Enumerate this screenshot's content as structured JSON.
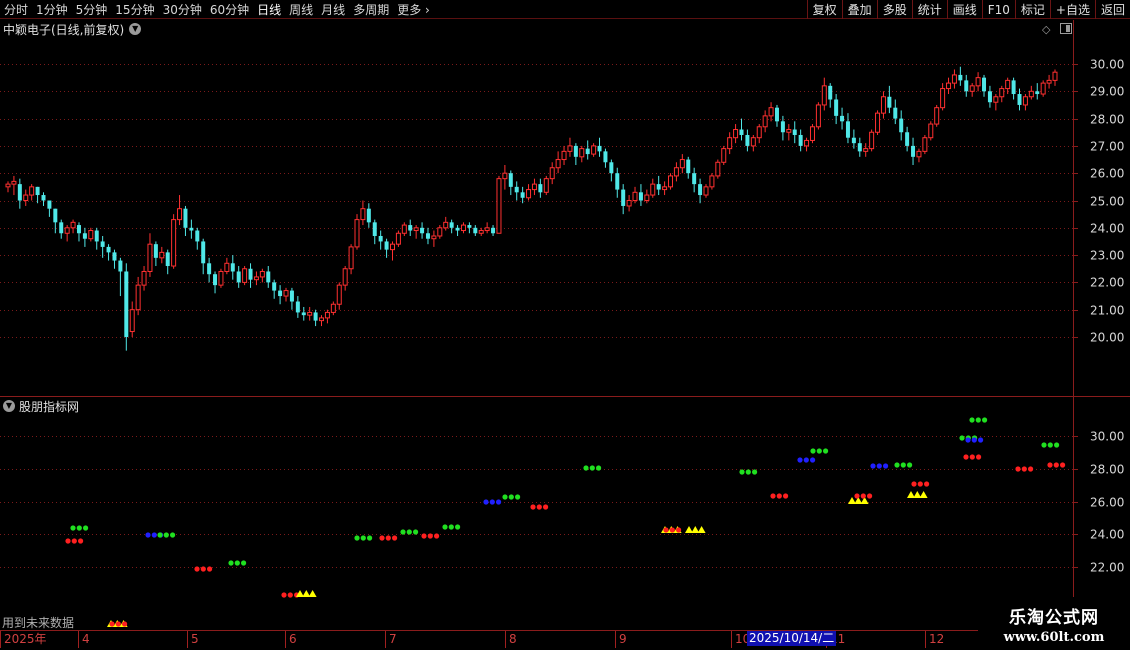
{
  "toolbar": {
    "periods": [
      "分时",
      "1分钟",
      "5分钟",
      "15分钟",
      "30分钟",
      "60分钟",
      "日线",
      "周线",
      "月线",
      "多周期",
      "更多"
    ],
    "active_period": "日线",
    "right_buttons": [
      "复权",
      "叠加",
      "多股",
      "统计",
      "画线",
      "F10",
      "标记",
      "+自选",
      "返回"
    ]
  },
  "main_chart": {
    "title": "中颖电子(日线,前复权)",
    "y_labels": [
      "30.00",
      "29.00",
      "28.00",
      "27.00",
      "26.00",
      "25.00",
      "24.00",
      "23.00",
      "22.00",
      "21.00",
      "20.00"
    ]
  },
  "panel": {
    "title": "股朋指标网",
    "y_labels": [
      "30.00",
      "28.00",
      "26.00",
      "24.00",
      "22.00"
    ],
    "note": "用到未来数据"
  },
  "date_axis": {
    "months": [
      "2025年",
      "4",
      "5",
      "6",
      "7",
      "8",
      "9",
      "10",
      "11",
      "12"
    ],
    "cursor_date": "2025/10/14/二"
  },
  "watermark": {
    "name": "乐淘公式网",
    "url": "www.60lt.com"
  },
  "colors": {
    "up": "#ff3030",
    "down": "#50e8e8",
    "grid": "#7a1a1a",
    "red_dot": "#ff2020",
    "green_dot": "#20e020",
    "blue_dot": "#2020ff",
    "yellow_tri": "#ffff00"
  },
  "chart_data": {
    "type": "candlestick",
    "ylim": [
      19.5,
      30.5
    ],
    "candles": [
      [
        25.5,
        25.7,
        25.6,
        25.3
      ],
      [
        25.6,
        25.9,
        25.7,
        25.2
      ],
      [
        25.6,
        25.8,
        25.0,
        24.7
      ],
      [
        25.0,
        25.4,
        25.2,
        24.8
      ],
      [
        25.2,
        25.6,
        25.5,
        25.0
      ],
      [
        25.5,
        25.5,
        25.2,
        24.9
      ],
      [
        25.2,
        25.3,
        25.0,
        24.8
      ],
      [
        25.0,
        25.0,
        24.7,
        24.4
      ],
      [
        24.7,
        24.7,
        24.2,
        23.8
      ],
      [
        24.2,
        24.3,
        23.8,
        23.6
      ],
      [
        23.8,
        24.1,
        24.0,
        23.5
      ],
      [
        24.0,
        24.3,
        24.2,
        23.8
      ],
      [
        24.1,
        24.2,
        23.8,
        23.5
      ],
      [
        23.8,
        24.0,
        23.6,
        23.3
      ],
      [
        23.6,
        24.0,
        23.9,
        23.5
      ],
      [
        23.9,
        24.0,
        23.5,
        23.2
      ],
      [
        23.5,
        23.7,
        23.3,
        22.9
      ],
      [
        23.3,
        23.4,
        23.1,
        22.8
      ],
      [
        23.1,
        23.2,
        22.8,
        22.5
      ],
      [
        22.8,
        22.9,
        22.4,
        21.5
      ],
      [
        22.4,
        22.7,
        20.0,
        19.5
      ],
      [
        20.2,
        21.3,
        21.0,
        20.0
      ],
      [
        21.0,
        22.2,
        21.9,
        20.8
      ],
      [
        21.9,
        22.6,
        22.4,
        21.7
      ],
      [
        22.4,
        23.8,
        23.4,
        22.2
      ],
      [
        23.4,
        23.5,
        22.9,
        22.6
      ],
      [
        22.9,
        23.3,
        23.1,
        22.7
      ],
      [
        23.1,
        23.2,
        22.6,
        22.3
      ],
      [
        22.6,
        24.5,
        24.3,
        22.5
      ],
      [
        24.3,
        25.2,
        24.7,
        24.1
      ],
      [
        24.7,
        24.8,
        24.0,
        23.7
      ],
      [
        24.0,
        24.3,
        23.9,
        23.6
      ],
      [
        23.9,
        24.0,
        23.5,
        23.2
      ],
      [
        23.5,
        23.6,
        22.7,
        22.3
      ],
      [
        22.7,
        22.9,
        22.3,
        22.0
      ],
      [
        22.3,
        22.4,
        21.9,
        21.6
      ],
      [
        21.9,
        22.5,
        22.4,
        21.8
      ],
      [
        22.4,
        22.9,
        22.7,
        22.3
      ],
      [
        22.7,
        23.0,
        22.4,
        22.1
      ],
      [
        22.4,
        22.6,
        22.0,
        21.8
      ],
      [
        22.0,
        22.6,
        22.5,
        21.9
      ],
      [
        22.5,
        22.7,
        22.1,
        21.8
      ],
      [
        22.1,
        22.4,
        22.2,
        21.9
      ],
      [
        22.2,
        22.5,
        22.4,
        22.0
      ],
      [
        22.4,
        22.6,
        22.0,
        21.8
      ],
      [
        22.0,
        22.1,
        21.7,
        21.4
      ],
      [
        21.7,
        21.9,
        21.5,
        21.2
      ],
      [
        21.5,
        21.8,
        21.7,
        21.3
      ],
      [
        21.7,
        21.8,
        21.3,
        21.0
      ],
      [
        21.3,
        21.5,
        20.9,
        20.7
      ],
      [
        20.9,
        21.1,
        20.8,
        20.6
      ],
      [
        20.8,
        21.1,
        20.9,
        20.6
      ],
      [
        20.9,
        21.0,
        20.6,
        20.4
      ],
      [
        20.6,
        20.8,
        20.7,
        20.4
      ],
      [
        20.7,
        21.0,
        20.9,
        20.5
      ],
      [
        20.9,
        21.3,
        21.2,
        20.8
      ],
      [
        21.2,
        22.0,
        21.9,
        21.0
      ],
      [
        21.9,
        22.6,
        22.5,
        21.7
      ],
      [
        22.5,
        23.4,
        23.3,
        22.3
      ],
      [
        23.3,
        24.5,
        24.3,
        23.2
      ],
      [
        24.3,
        25.0,
        24.7,
        24.1
      ],
      [
        24.7,
        24.9,
        24.2,
        24.0
      ],
      [
        24.2,
        24.3,
        23.7,
        23.4
      ],
      [
        23.7,
        23.9,
        23.5,
        23.2
      ],
      [
        23.5,
        23.6,
        23.2,
        22.9
      ],
      [
        23.2,
        23.5,
        23.4,
        22.8
      ],
      [
        23.4,
        23.9,
        23.8,
        23.3
      ],
      [
        23.8,
        24.2,
        24.1,
        23.7
      ],
      [
        24.1,
        24.3,
        23.9,
        23.7
      ],
      [
        23.9,
        24.1,
        24.0,
        23.6
      ],
      [
        24.0,
        24.2,
        23.8,
        23.6
      ],
      [
        23.8,
        24.0,
        23.6,
        23.4
      ],
      [
        23.6,
        23.9,
        23.7,
        23.3
      ],
      [
        23.7,
        24.1,
        24.0,
        23.6
      ],
      [
        24.0,
        24.4,
        24.2,
        23.9
      ],
      [
        24.2,
        24.3,
        24.0,
        23.8
      ],
      [
        24.0,
        24.1,
        23.9,
        23.7
      ],
      [
        23.9,
        24.2,
        24.1,
        23.8
      ],
      [
        24.1,
        24.2,
        24.0,
        23.8
      ],
      [
        24.0,
        24.1,
        23.8,
        23.7
      ],
      [
        23.8,
        24.0,
        23.9,
        23.7
      ],
      [
        23.9,
        24.2,
        24.0,
        23.8
      ],
      [
        24.0,
        24.1,
        23.8,
        23.7
      ],
      [
        23.8,
        25.9,
        25.8,
        23.8
      ],
      [
        25.8,
        26.3,
        26.0,
        25.4
      ],
      [
        26.0,
        26.1,
        25.5,
        25.2
      ],
      [
        25.5,
        25.7,
        25.3,
        25.0
      ],
      [
        25.3,
        25.5,
        25.1,
        24.9
      ],
      [
        25.1,
        25.6,
        25.4,
        25.0
      ],
      [
        25.4,
        25.8,
        25.6,
        25.2
      ],
      [
        25.6,
        25.8,
        25.3,
        25.1
      ],
      [
        25.3,
        25.9,
        25.8,
        25.2
      ],
      [
        25.8,
        26.4,
        26.2,
        25.6
      ],
      [
        26.2,
        26.8,
        26.5,
        26.0
      ],
      [
        26.5,
        27.0,
        26.8,
        26.3
      ],
      [
        26.8,
        27.3,
        27.0,
        26.6
      ],
      [
        27.0,
        27.1,
        26.6,
        26.3
      ],
      [
        26.6,
        27.0,
        26.9,
        26.4
      ],
      [
        26.9,
        27.2,
        26.7,
        26.5
      ],
      [
        26.7,
        27.1,
        27.0,
        26.6
      ],
      [
        27.0,
        27.3,
        26.8,
        26.6
      ],
      [
        26.8,
        26.9,
        26.4,
        26.2
      ],
      [
        26.4,
        26.5,
        26.0,
        25.7
      ],
      [
        26.0,
        26.2,
        25.4,
        25.1
      ],
      [
        25.4,
        25.6,
        24.8,
        24.5
      ],
      [
        24.8,
        25.2,
        25.0,
        24.6
      ],
      [
        25.0,
        25.5,
        25.3,
        24.9
      ],
      [
        25.3,
        25.6,
        25.0,
        24.8
      ],
      [
        25.0,
        25.4,
        25.2,
        24.9
      ],
      [
        25.2,
        25.8,
        25.6,
        25.1
      ],
      [
        25.6,
        25.9,
        25.4,
        25.2
      ],
      [
        25.4,
        25.7,
        25.5,
        25.2
      ],
      [
        25.5,
        26.0,
        25.9,
        25.4
      ],
      [
        25.9,
        26.4,
        26.2,
        25.7
      ],
      [
        26.2,
        26.7,
        26.5,
        26.0
      ],
      [
        26.5,
        26.6,
        26.0,
        25.8
      ],
      [
        26.0,
        26.2,
        25.6,
        25.3
      ],
      [
        25.6,
        25.8,
        25.2,
        24.9
      ],
      [
        25.2,
        25.6,
        25.5,
        25.1
      ],
      [
        25.5,
        26.0,
        25.9,
        25.4
      ],
      [
        25.9,
        26.5,
        26.4,
        25.8
      ],
      [
        26.4,
        27.0,
        26.9,
        26.3
      ],
      [
        26.9,
        27.5,
        27.3,
        26.7
      ],
      [
        27.3,
        27.8,
        27.6,
        27.1
      ],
      [
        27.6,
        28.0,
        27.4,
        27.2
      ],
      [
        27.4,
        27.6,
        27.0,
        26.8
      ],
      [
        27.0,
        27.4,
        27.3,
        26.8
      ],
      [
        27.3,
        27.8,
        27.7,
        27.1
      ],
      [
        27.7,
        28.3,
        28.1,
        27.5
      ],
      [
        28.1,
        28.6,
        28.4,
        27.9
      ],
      [
        28.4,
        28.5,
        27.9,
        27.7
      ],
      [
        27.9,
        28.1,
        27.5,
        27.2
      ],
      [
        27.5,
        27.8,
        27.6,
        27.2
      ],
      [
        27.6,
        27.9,
        27.4,
        27.1
      ],
      [
        27.4,
        27.6,
        27.0,
        26.8
      ],
      [
        27.0,
        27.3,
        27.2,
        26.8
      ],
      [
        27.2,
        27.8,
        27.7,
        27.1
      ],
      [
        27.7,
        28.6,
        28.5,
        27.6
      ],
      [
        28.5,
        29.5,
        29.2,
        28.3
      ],
      [
        29.2,
        29.3,
        28.7,
        28.4
      ],
      [
        28.7,
        28.9,
        28.1,
        27.8
      ],
      [
        28.1,
        28.4,
        27.9,
        27.6
      ],
      [
        27.9,
        28.2,
        27.3,
        27.1
      ],
      [
        27.3,
        27.6,
        27.1,
        26.9
      ],
      [
        27.1,
        27.3,
        26.8,
        26.6
      ],
      [
        26.8,
        27.1,
        26.9,
        26.6
      ],
      [
        26.9,
        27.6,
        27.5,
        26.8
      ],
      [
        27.5,
        28.3,
        28.2,
        27.4
      ],
      [
        28.2,
        29.0,
        28.8,
        28.0
      ],
      [
        28.8,
        29.2,
        28.4,
        28.2
      ],
      [
        28.4,
        28.7,
        28.0,
        27.8
      ],
      [
        28.0,
        28.3,
        27.5,
        27.2
      ],
      [
        27.5,
        27.7,
        27.0,
        26.8
      ],
      [
        27.0,
        27.3,
        26.6,
        26.3
      ],
      [
        26.6,
        26.9,
        26.8,
        26.4
      ],
      [
        26.8,
        27.4,
        27.3,
        26.7
      ],
      [
        27.3,
        27.9,
        27.8,
        27.2
      ],
      [
        27.8,
        28.5,
        28.4,
        27.7
      ],
      [
        28.4,
        29.3,
        29.1,
        28.3
      ],
      [
        29.1,
        29.5,
        29.3,
        28.9
      ],
      [
        29.3,
        29.8,
        29.6,
        29.1
      ],
      [
        29.6,
        29.9,
        29.4,
        29.2
      ],
      [
        29.4,
        29.6,
        29.0,
        28.8
      ],
      [
        29.0,
        29.3,
        29.2,
        28.8
      ],
      [
        29.2,
        29.7,
        29.5,
        29.0
      ],
      [
        29.5,
        29.6,
        29.0,
        28.8
      ],
      [
        29.0,
        29.2,
        28.6,
        28.4
      ],
      [
        28.6,
        28.9,
        28.8,
        28.3
      ],
      [
        28.8,
        29.2,
        29.1,
        28.6
      ],
      [
        29.1,
        29.5,
        29.4,
        28.9
      ],
      [
        29.4,
        29.5,
        28.9,
        28.7
      ],
      [
        28.9,
        29.1,
        28.5,
        28.3
      ],
      [
        28.5,
        28.9,
        28.8,
        28.3
      ],
      [
        28.8,
        29.2,
        29.0,
        28.7
      ],
      [
        29.0,
        29.3,
        28.9,
        28.7
      ],
      [
        28.9,
        29.4,
        29.3,
        28.8
      ],
      [
        29.3,
        29.6,
        29.4,
        29.1
      ],
      [
        29.4,
        29.8,
        29.7,
        29.2
      ]
    ]
  }
}
